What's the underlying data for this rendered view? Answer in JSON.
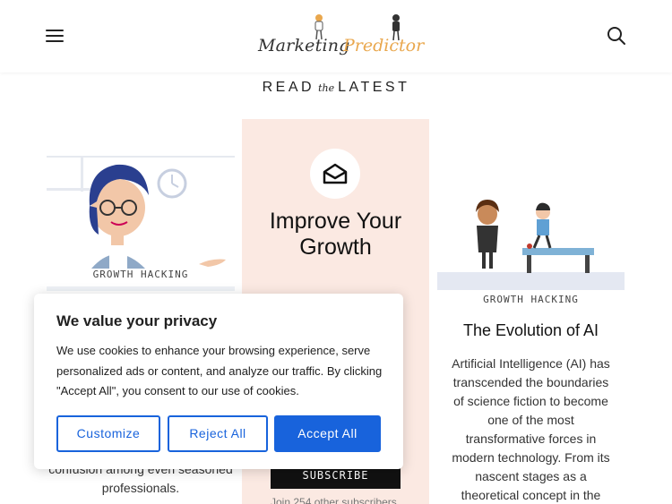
{
  "header": {
    "logo_word1": "Marketing",
    "logo_word2": "Predictor"
  },
  "section": {
    "read": "READ",
    "the": "the",
    "latest": "LATEST"
  },
  "cards": {
    "left": {
      "tag": "GROWTH HACKING",
      "excerpt": "confusion among even seasoned professionals."
    },
    "middle": {
      "headline": "Improve Your Growth",
      "subscribe_label": "SUBSCRIBE",
      "join_text": "Join 254 other subscribers"
    },
    "right": {
      "tag": "GROWTH HACKING",
      "title": "The Evolution of AI",
      "excerpt": "Artificial Intelligence (AI) has transcended the boundaries of science fiction to become one of the most transformative forces in modern technology. From its nascent stages as a theoretical concept in the"
    }
  },
  "cookie": {
    "title": "We value your privacy",
    "body": "We use cookies to enhance your browsing experience, serve personalized ads or content, and analyze our traffic. By clicking \"Accept All\", you consent to our use of cookies.",
    "customize_label": "Customize",
    "reject_label": "Reject All",
    "accept_label": "Accept All"
  },
  "colors": {
    "accent": "#1863dc",
    "promo_bg": "#fbe9e2",
    "logo_orange": "#e9a74d"
  },
  "icons": [
    "hamburger-menu-icon",
    "search-icon",
    "envelope-icon"
  ]
}
